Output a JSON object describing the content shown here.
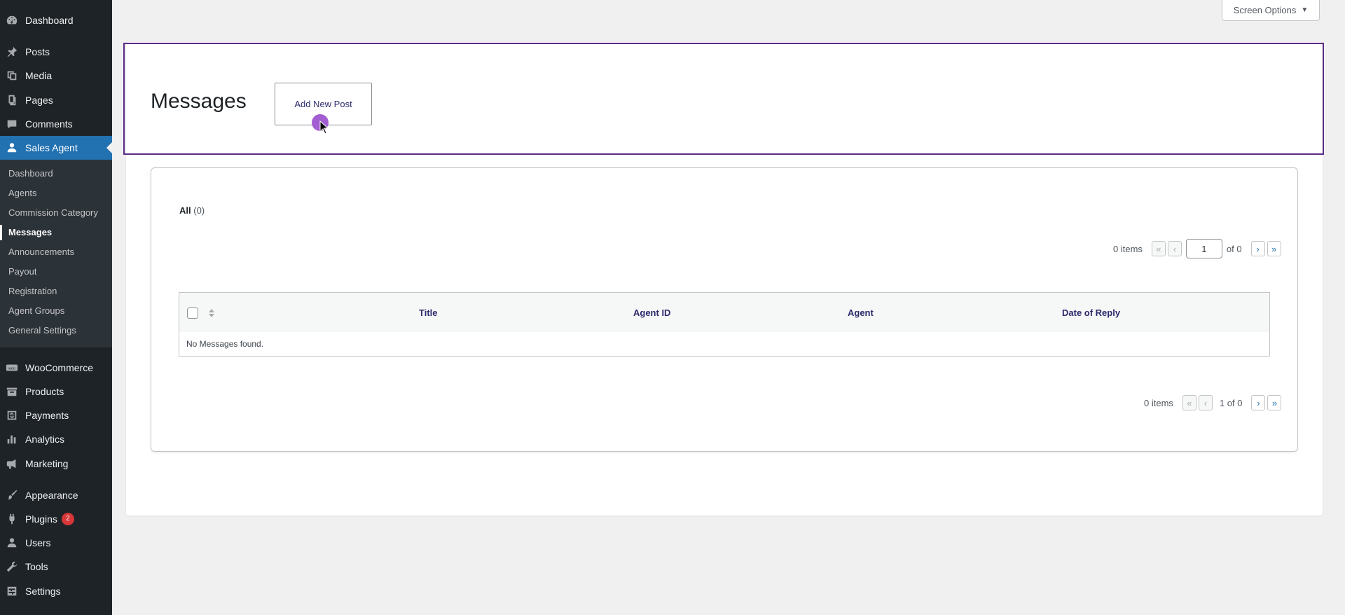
{
  "sidebar": {
    "top_items": [
      {
        "label": "Dashboard",
        "icon": "dashboard-icon"
      },
      {
        "label": "Posts",
        "icon": "pin-icon"
      },
      {
        "label": "Media",
        "icon": "media-icon"
      },
      {
        "label": "Pages",
        "icon": "pages-icon"
      },
      {
        "label": "Comments",
        "icon": "comment-icon"
      },
      {
        "label": "Sales Agent",
        "icon": "user-icon"
      }
    ],
    "submenu": [
      {
        "label": "Dashboard"
      },
      {
        "label": "Agents"
      },
      {
        "label": "Commission Category"
      },
      {
        "label": "Messages"
      },
      {
        "label": "Announcements"
      },
      {
        "label": "Payout"
      },
      {
        "label": "Registration"
      },
      {
        "label": "Agent Groups"
      },
      {
        "label": "General Settings"
      }
    ],
    "bottom_items": [
      {
        "label": "WooCommerce",
        "icon": "woo-icon"
      },
      {
        "label": "Products",
        "icon": "archive-icon"
      },
      {
        "label": "Payments",
        "icon": "dollar-icon"
      },
      {
        "label": "Analytics",
        "icon": "chart-bar-icon"
      },
      {
        "label": "Marketing",
        "icon": "megaphone-icon"
      },
      {
        "label": "Appearance",
        "icon": "brush-icon"
      },
      {
        "label": "Plugins",
        "icon": "plug-icon",
        "badge": "2"
      },
      {
        "label": "Users",
        "icon": "users-icon"
      },
      {
        "label": "Tools",
        "icon": "wrench-icon"
      },
      {
        "label": "Settings",
        "icon": "settings-icon"
      }
    ],
    "active_color": "#2271b1"
  },
  "header": {
    "screen_options": "Screen Options",
    "screen_options_arrow": "▼"
  },
  "page": {
    "title": "Messages",
    "add_new": "Add New Post"
  },
  "filters": {
    "all_label": "All",
    "all_count": "(0)"
  },
  "pagination_top": {
    "items": "0 items",
    "first": "«",
    "prev": "‹",
    "current_page": "1",
    "of_total": "of 0",
    "next": "›",
    "last": "»"
  },
  "table": {
    "columns": [
      "Title",
      "Agent ID",
      "Agent",
      "Date of Reply"
    ],
    "empty_message": "No Messages found."
  },
  "pagination_bottom": {
    "items": "0 items",
    "first": "«",
    "prev": "‹",
    "page_info": "1 of 0",
    "next": "›",
    "last": "»"
  },
  "colors": {
    "highlight_border": "#5b2a86",
    "cursor_dot": "#a35ed2",
    "badge": "#d63638"
  }
}
